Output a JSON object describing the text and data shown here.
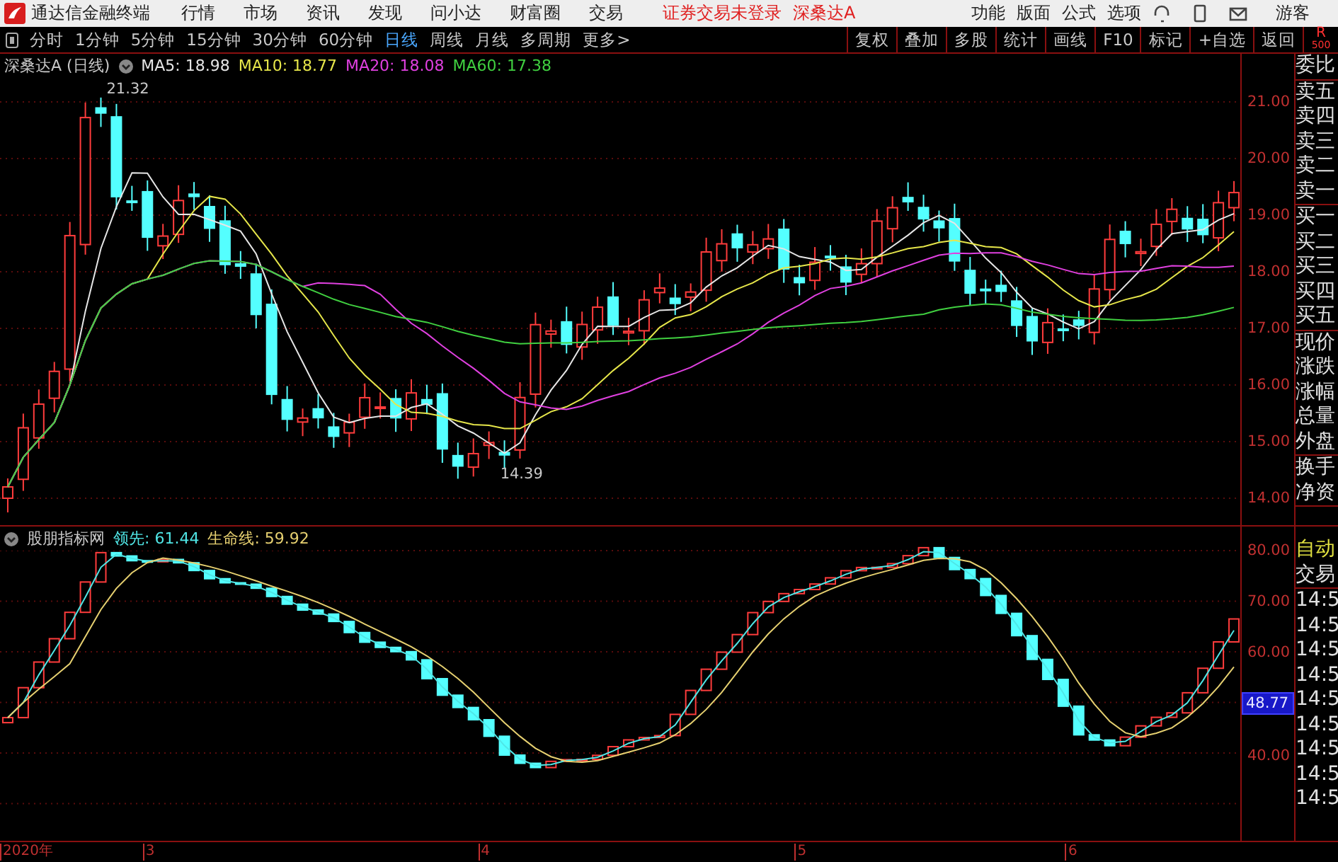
{
  "app_bar": {
    "title": "通达信金融终端",
    "menu": [
      "行情",
      "市场",
      "资讯",
      "发现",
      "问小达",
      "财富圈",
      "交易"
    ],
    "status": [
      "证券交易未登录",
      "深桑达A"
    ],
    "actions": [
      "功能",
      "版面",
      "公式",
      "选项"
    ],
    "user": "游客"
  },
  "period_bar": {
    "periods": [
      {
        "label": "分时",
        "selected": false
      },
      {
        "label": "1分钟",
        "selected": false
      },
      {
        "label": "5分钟",
        "selected": false
      },
      {
        "label": "15分钟",
        "selected": false
      },
      {
        "label": "30分钟",
        "selected": false
      },
      {
        "label": "60分钟",
        "selected": false
      },
      {
        "label": "日线",
        "selected": true
      },
      {
        "label": "周线",
        "selected": false
      },
      {
        "label": "月线",
        "selected": false
      },
      {
        "label": "多周期",
        "selected": false
      },
      {
        "label": "更多>",
        "selected": false
      }
    ],
    "tools": [
      "复权",
      "叠加",
      "多股",
      "统计",
      "画线",
      "F10",
      "标记",
      "+自选",
      "返回"
    ],
    "badge": {
      "label": "R",
      "sub": "500"
    }
  },
  "price_chart": {
    "title": "深桑达A (日线)",
    "indicators": [
      {
        "label": "MA5: 18.98",
        "color": "#e6e6e6"
      },
      {
        "label": "MA10: 18.77",
        "color": "#e6e64a"
      },
      {
        "label": "MA20: 18.08",
        "color": "#e040e0"
      },
      {
        "label": "MA60: 17.38",
        "color": "#40d040"
      }
    ],
    "high_label": "21.32",
    "low_label": "14.39",
    "axis_labels": [
      "21.00",
      "20.00",
      "19.00",
      "18.00",
      "17.00",
      "16.00",
      "15.00",
      "14.00"
    ]
  },
  "indicator_chart": {
    "title": "股朋指标网",
    "lines": [
      {
        "label": "领先: 61.44",
        "color": "#50e6e6"
      },
      {
        "label": "生命线: 59.92",
        "color": "#e6d070"
      }
    ],
    "axis_labels": [
      {
        "label": "80.00",
        "kind": "tick"
      },
      {
        "label": "70.00",
        "kind": "tick"
      },
      {
        "label": "60.00",
        "kind": "tick"
      },
      {
        "label": "48.77",
        "kind": "current"
      },
      {
        "label": "40.00",
        "kind": "tick"
      }
    ]
  },
  "time_axis": [
    "2020年",
    "3",
    "4",
    "5",
    "6"
  ],
  "quote_panel": {
    "groups": [
      [
        "委比"
      ],
      [
        "卖五",
        "卖四",
        "卖三",
        "卖二",
        "卖一"
      ],
      [
        "买一",
        "买二",
        "买三",
        "买四",
        "买五"
      ],
      [
        "现价",
        "涨跌",
        "涨幅",
        "总量",
        "外盘"
      ],
      [
        "换手",
        "净资"
      ]
    ]
  },
  "trade_panel": {
    "mode": "自动",
    "title": "交易",
    "times": [
      "14:5",
      "14:5",
      "14:5",
      "14:5",
      "14:5",
      "14:5",
      "14:5",
      "14:5",
      "14:5"
    ]
  }
}
